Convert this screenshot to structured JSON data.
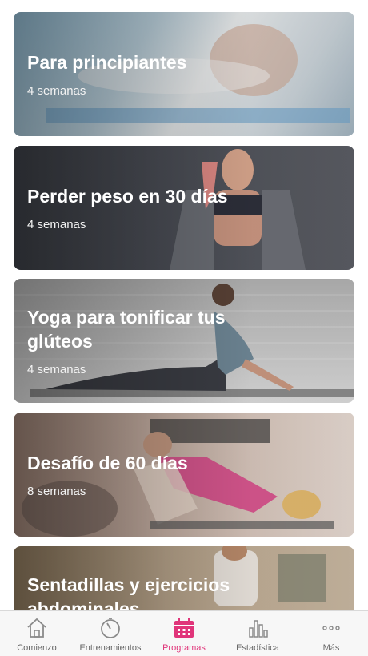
{
  "programs": [
    {
      "title": "Para principiantes",
      "duration": "4 semanas"
    },
    {
      "title": "Perder peso en 30 días",
      "duration": "4 semanas"
    },
    {
      "title": "Yoga para tonificar tus glúteos",
      "duration": "4 semanas"
    },
    {
      "title": "Desafío de 60 días",
      "duration": "8 semanas"
    },
    {
      "title": "Sentadillas y ejercicios abdominales",
      "duration": ""
    }
  ],
  "tabbar": {
    "items": [
      {
        "label": "Comienzo",
        "icon": "home-icon"
      },
      {
        "label": "Entrenamientos",
        "icon": "stopwatch-icon"
      },
      {
        "label": "Programas",
        "icon": "calendar-icon",
        "active": true
      },
      {
        "label": "Estadística",
        "icon": "bar-chart-icon"
      },
      {
        "label": "Más",
        "icon": "more-icon"
      }
    ]
  },
  "colors": {
    "accent": "#e0357a",
    "tab_inactive": "#666666"
  }
}
